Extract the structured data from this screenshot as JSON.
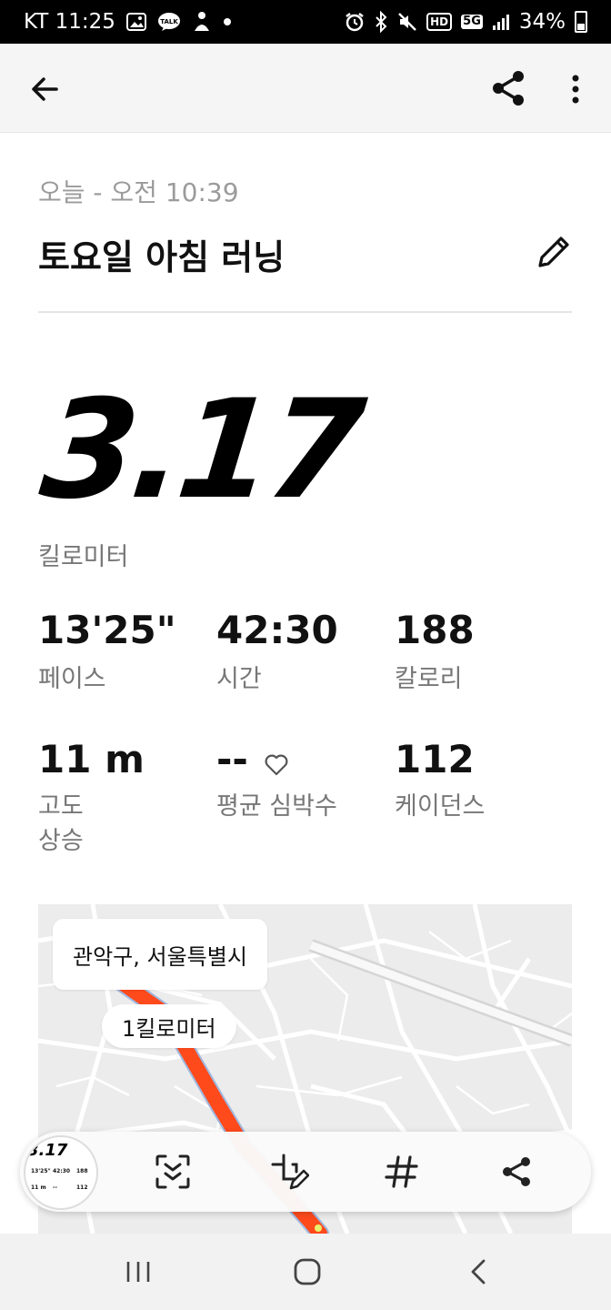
{
  "status_bar": {
    "carrier_time": "KT 11:25",
    "battery": "34%",
    "network": "5G",
    "hd": "HD",
    "left_icons": [
      "gallery-icon",
      "kakaotalk-icon",
      "app-notification-icon",
      "dot-icon"
    ],
    "right_icons": [
      "alarm-icon",
      "bluetooth-icon",
      "mute-icon",
      "hd-icon",
      "5g-icon",
      "signal-icon",
      "battery-icon"
    ]
  },
  "app_bar": {
    "icons": [
      "back-arrow-icon",
      "share-icon",
      "more-vert-icon"
    ]
  },
  "activity": {
    "date": "오늘 - 오전 10:39",
    "title": "토요일 아침 러닝",
    "distance": "3.17",
    "distance_unit": "킬로미터"
  },
  "stats": [
    {
      "value": "13'25\"",
      "label": "페이스"
    },
    {
      "value": "42:30",
      "label": "시간"
    },
    {
      "value": "188",
      "label": "칼로리"
    },
    {
      "value": "11 m",
      "label": "고도\n상승"
    },
    {
      "value": "--",
      "label": "평균 심박수"
    },
    {
      "value": "112",
      "label": "케이던스"
    }
  ],
  "map": {
    "location": "관악구, 서울특별시",
    "marker": "1킬로미터",
    "route_color": "#ff4a1c"
  },
  "toolbar": {
    "thumb_distance": "3.17",
    "thumb_stats": [
      "13'25\"",
      "42:30",
      "188",
      "11 m",
      "--",
      "112"
    ],
    "icons": [
      "scan-icon",
      "edit-screenshot-icon",
      "hashtag-icon",
      "share-icon"
    ]
  },
  "nav_bar": {
    "icons": [
      "recents-icon",
      "home-icon",
      "back-icon"
    ]
  },
  "colors": {
    "accent_orange": "#ff4a1c",
    "muted_text": "#777777",
    "date_text": "#9b9b9b"
  }
}
